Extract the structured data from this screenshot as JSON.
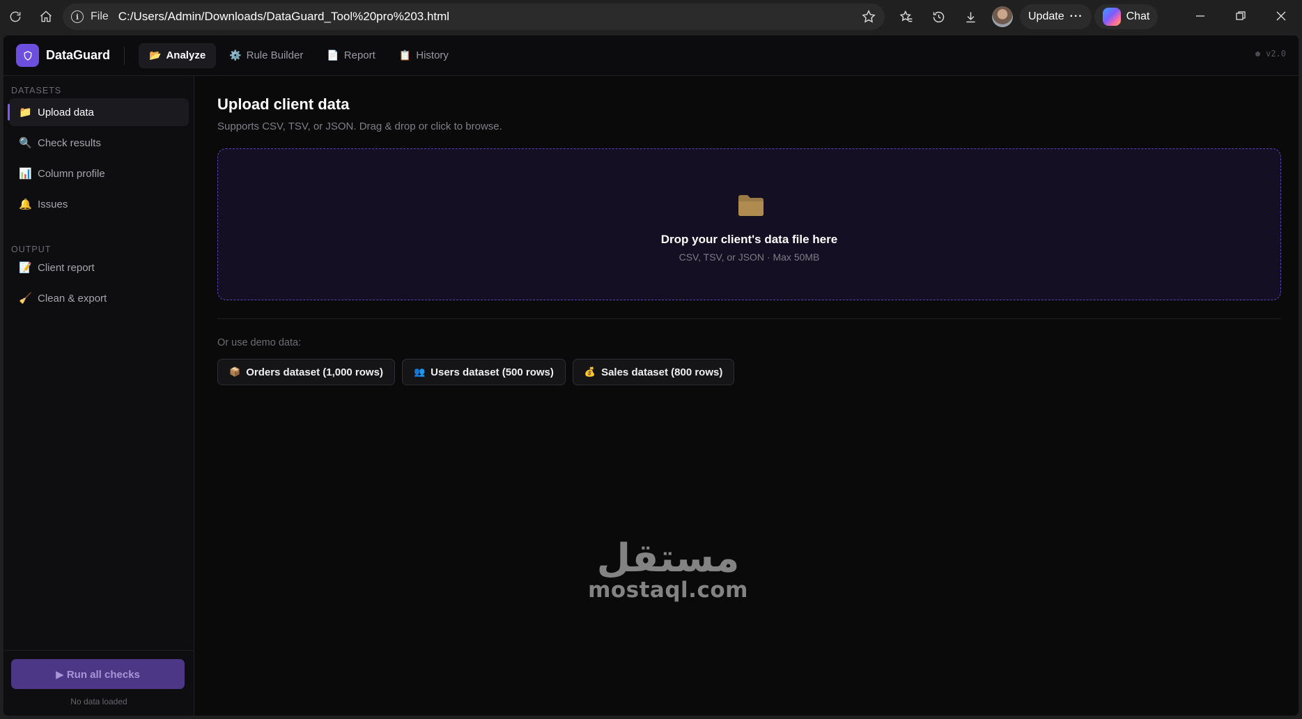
{
  "browser": {
    "scheme": "File",
    "url": "C:/Users/Admin/Downloads/DataGuard_Tool%20pro%203.html",
    "update_label": "Update",
    "chat_label": "Chat"
  },
  "app": {
    "brand": "DataGuard",
    "version": "v2.0",
    "accent": "#6d4fe0",
    "tabs": [
      {
        "icon": "📂",
        "label": "Analyze"
      },
      {
        "icon": "⚙️",
        "label": "Rule Builder"
      },
      {
        "icon": "📄",
        "label": "Report"
      },
      {
        "icon": "📋",
        "label": "History"
      }
    ]
  },
  "sidebar": {
    "datasets_label": "DATASETS",
    "output_label": "OUTPUT",
    "datasets": [
      {
        "icon": "📁",
        "label": "Upload data"
      },
      {
        "icon": "🔍",
        "label": "Check results"
      },
      {
        "icon": "📊",
        "label": "Column profile"
      },
      {
        "icon": "🔔",
        "label": "Issues"
      }
    ],
    "output": [
      {
        "icon": "📝",
        "label": "Client report"
      },
      {
        "icon": "🧹",
        "label": "Clean & export"
      }
    ],
    "run_button": "▶ Run all checks",
    "status": "No data loaded"
  },
  "main": {
    "title": "Upload client data",
    "subtitle": "Supports CSV, TSV, or JSON. Drag & drop or click to browse.",
    "drop_title": "Drop your client's data file here",
    "drop_sub": "CSV, TSV, or JSON · Max 50MB",
    "demo_label": "Or use demo data:",
    "demo_buttons": [
      {
        "icon": "📦",
        "label": "Orders dataset (1,000 rows)"
      },
      {
        "icon": "👥",
        "label": "Users dataset (500 rows)"
      },
      {
        "icon": "💰",
        "label": "Sales dataset (800 rows)"
      }
    ]
  },
  "watermark": {
    "arabic": "مستقل",
    "latin": "mostaql.com"
  }
}
